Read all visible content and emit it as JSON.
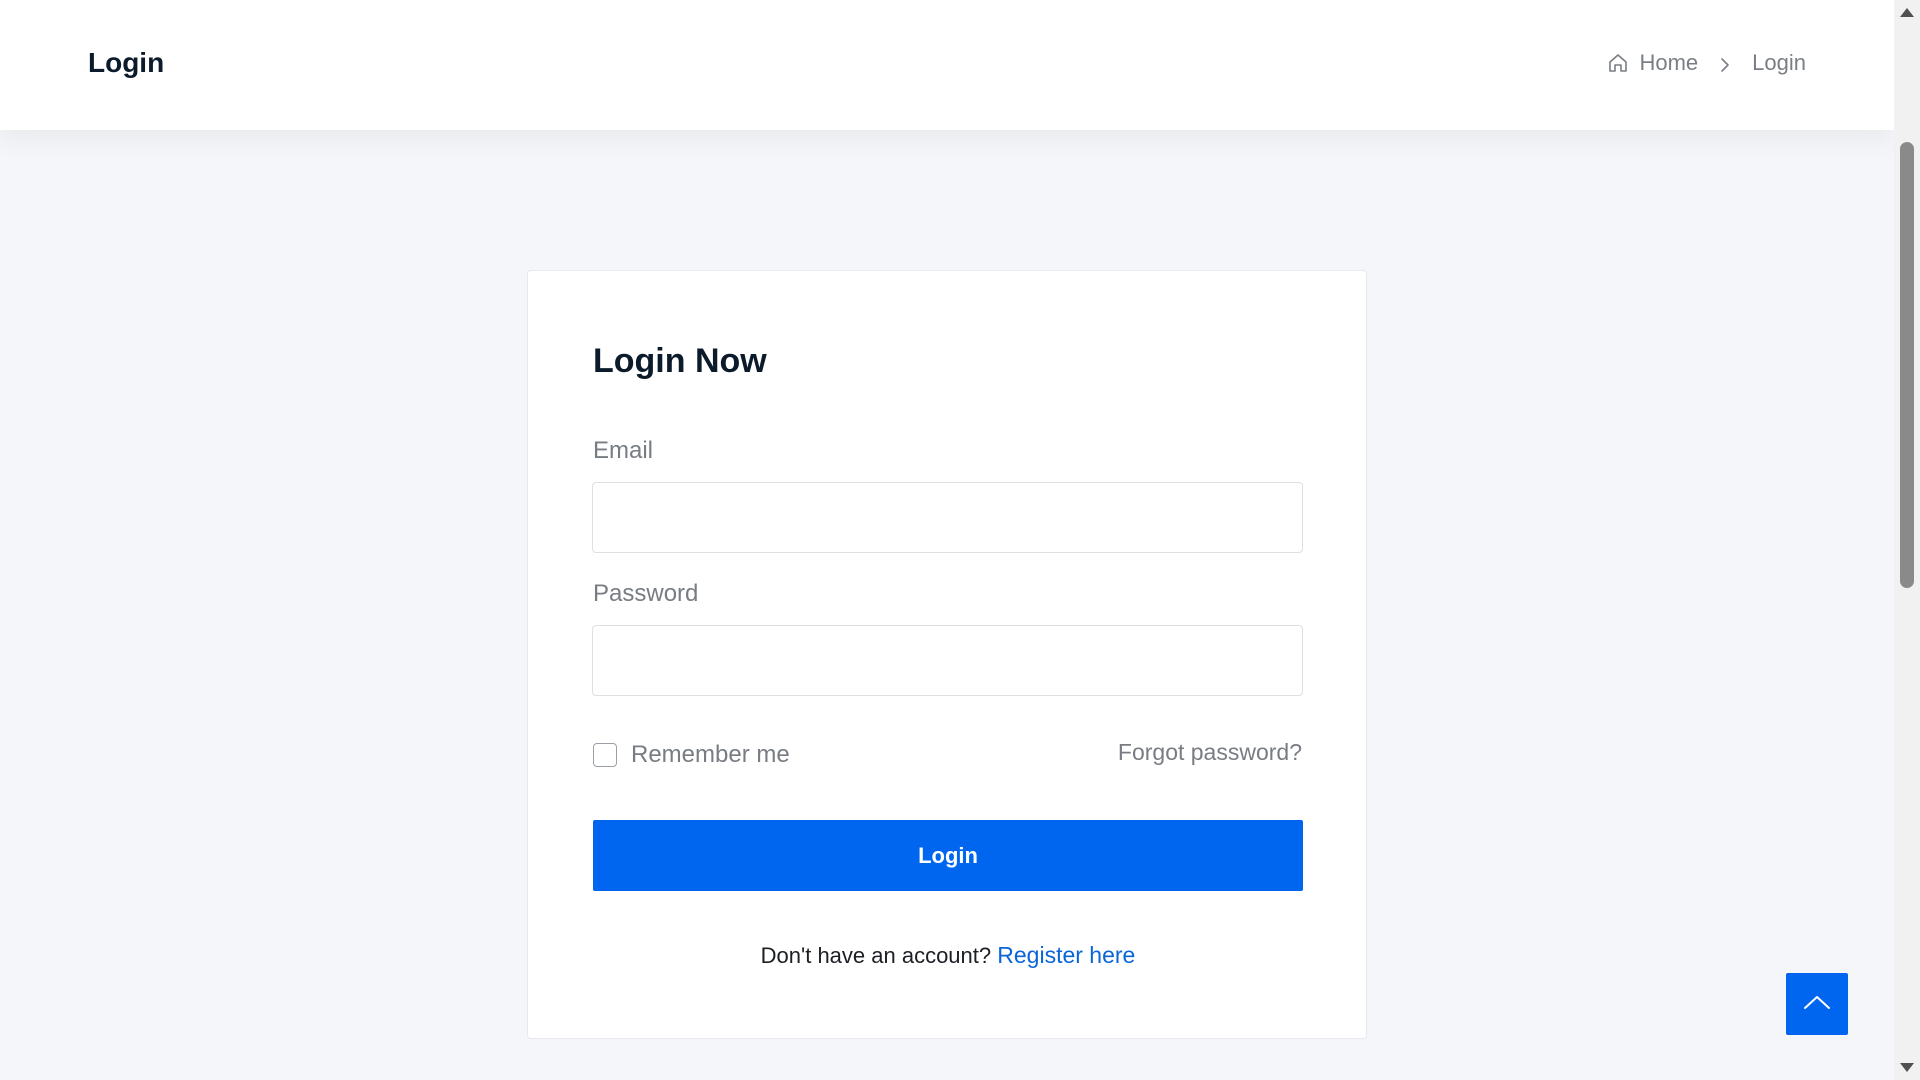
{
  "header": {
    "title": "Login",
    "breadcrumb": {
      "home_label": "Home",
      "current_label": "Login",
      "home_icon": "home-icon",
      "separator_icon": "chevron-right-icon"
    }
  },
  "login_card": {
    "title": "Login Now",
    "email_label": "Email",
    "email_value": "",
    "password_label": "Password",
    "password_value": "",
    "remember_label": "Remember me",
    "remember_checked": false,
    "forgot_label": "Forgot password?",
    "submit_label": "Login",
    "register_prompt": "Don't have an account?",
    "register_link": "Register here"
  },
  "back_to_top": {
    "icon": "chevron-up-icon"
  },
  "colors": {
    "accent": "#0066f0",
    "link": "#0a66d8",
    "background": "#f4f6f9",
    "heading": "#0b1b2b",
    "muted": "#787d83"
  }
}
